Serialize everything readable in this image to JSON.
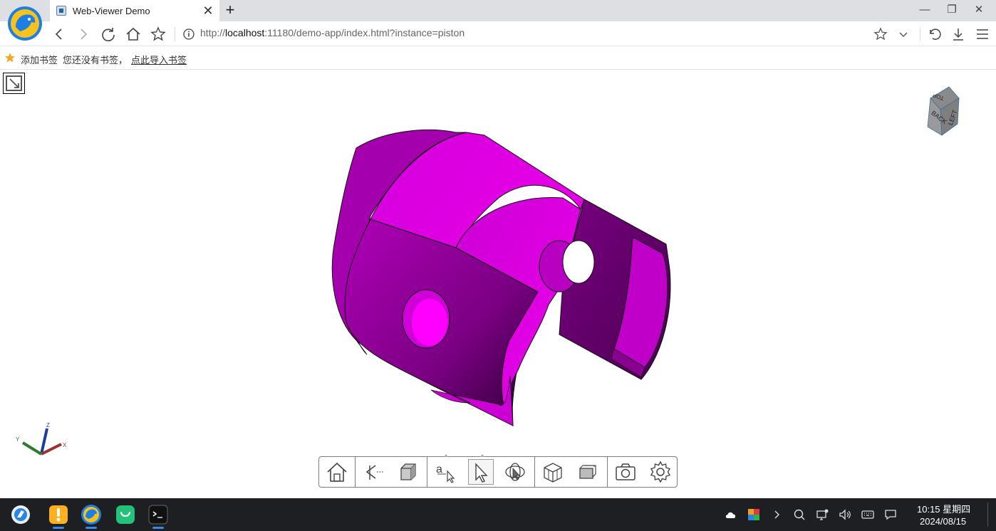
{
  "browser": {
    "tab": {
      "title": "Web-Viewer Demo",
      "close": "✕"
    },
    "new_tab": "+",
    "window_controls": {
      "minimize": "—",
      "restore": "❐",
      "close": "✕"
    },
    "url": {
      "scheme": "http://",
      "host": "localhost",
      "rest": ":11180/demo-app/index.html?instance=piston"
    },
    "icons": [
      "back-icon",
      "forward-icon",
      "reload-icon",
      "home-icon",
      "bookmark-star-icon",
      "info-icon",
      "star-icon",
      "chevron-down-icon",
      "undo-icon",
      "download-icon",
      "menu-icon"
    ]
  },
  "bookmarks": {
    "add_label": "添加书签",
    "empty_text": "您还没有书签，",
    "import_link": "点此导入书签"
  },
  "viewer": {
    "model_color": "#e600e6",
    "navcube_faces": {
      "top": "TOP",
      "front": "BACK",
      "side": "LEFT"
    },
    "axes": {
      "x": "X",
      "y": "Y",
      "z": "Z"
    },
    "toolbar_tools": [
      {
        "name": "home-tool",
        "icon": "home-icon"
      },
      {
        "name": "camera-view-tool",
        "icon": "camera-view-icon"
      },
      {
        "name": "shaded-box-tool",
        "icon": "shaded-box-icon"
      },
      {
        "name": "markup-tool",
        "icon": "markup-text-icon"
      },
      {
        "name": "select-tool",
        "icon": "select-arrow-icon",
        "active": true
      },
      {
        "name": "orbit-tool",
        "icon": "orbit-icon"
      },
      {
        "name": "model-tree-tool",
        "icon": "model-tree-icon"
      },
      {
        "name": "views-tool",
        "icon": "views-icon"
      },
      {
        "name": "snapshot-tool",
        "icon": "camera-icon"
      },
      {
        "name": "settings-tool",
        "icon": "gear-icon"
      }
    ]
  },
  "taskbar": {
    "apps": [
      "launcher-icon",
      "file-manager-icon",
      "browser-icon",
      "app-store-icon",
      "terminal-icon"
    ],
    "time": "10:15 星期四",
    "date": "2024/08/15"
  }
}
